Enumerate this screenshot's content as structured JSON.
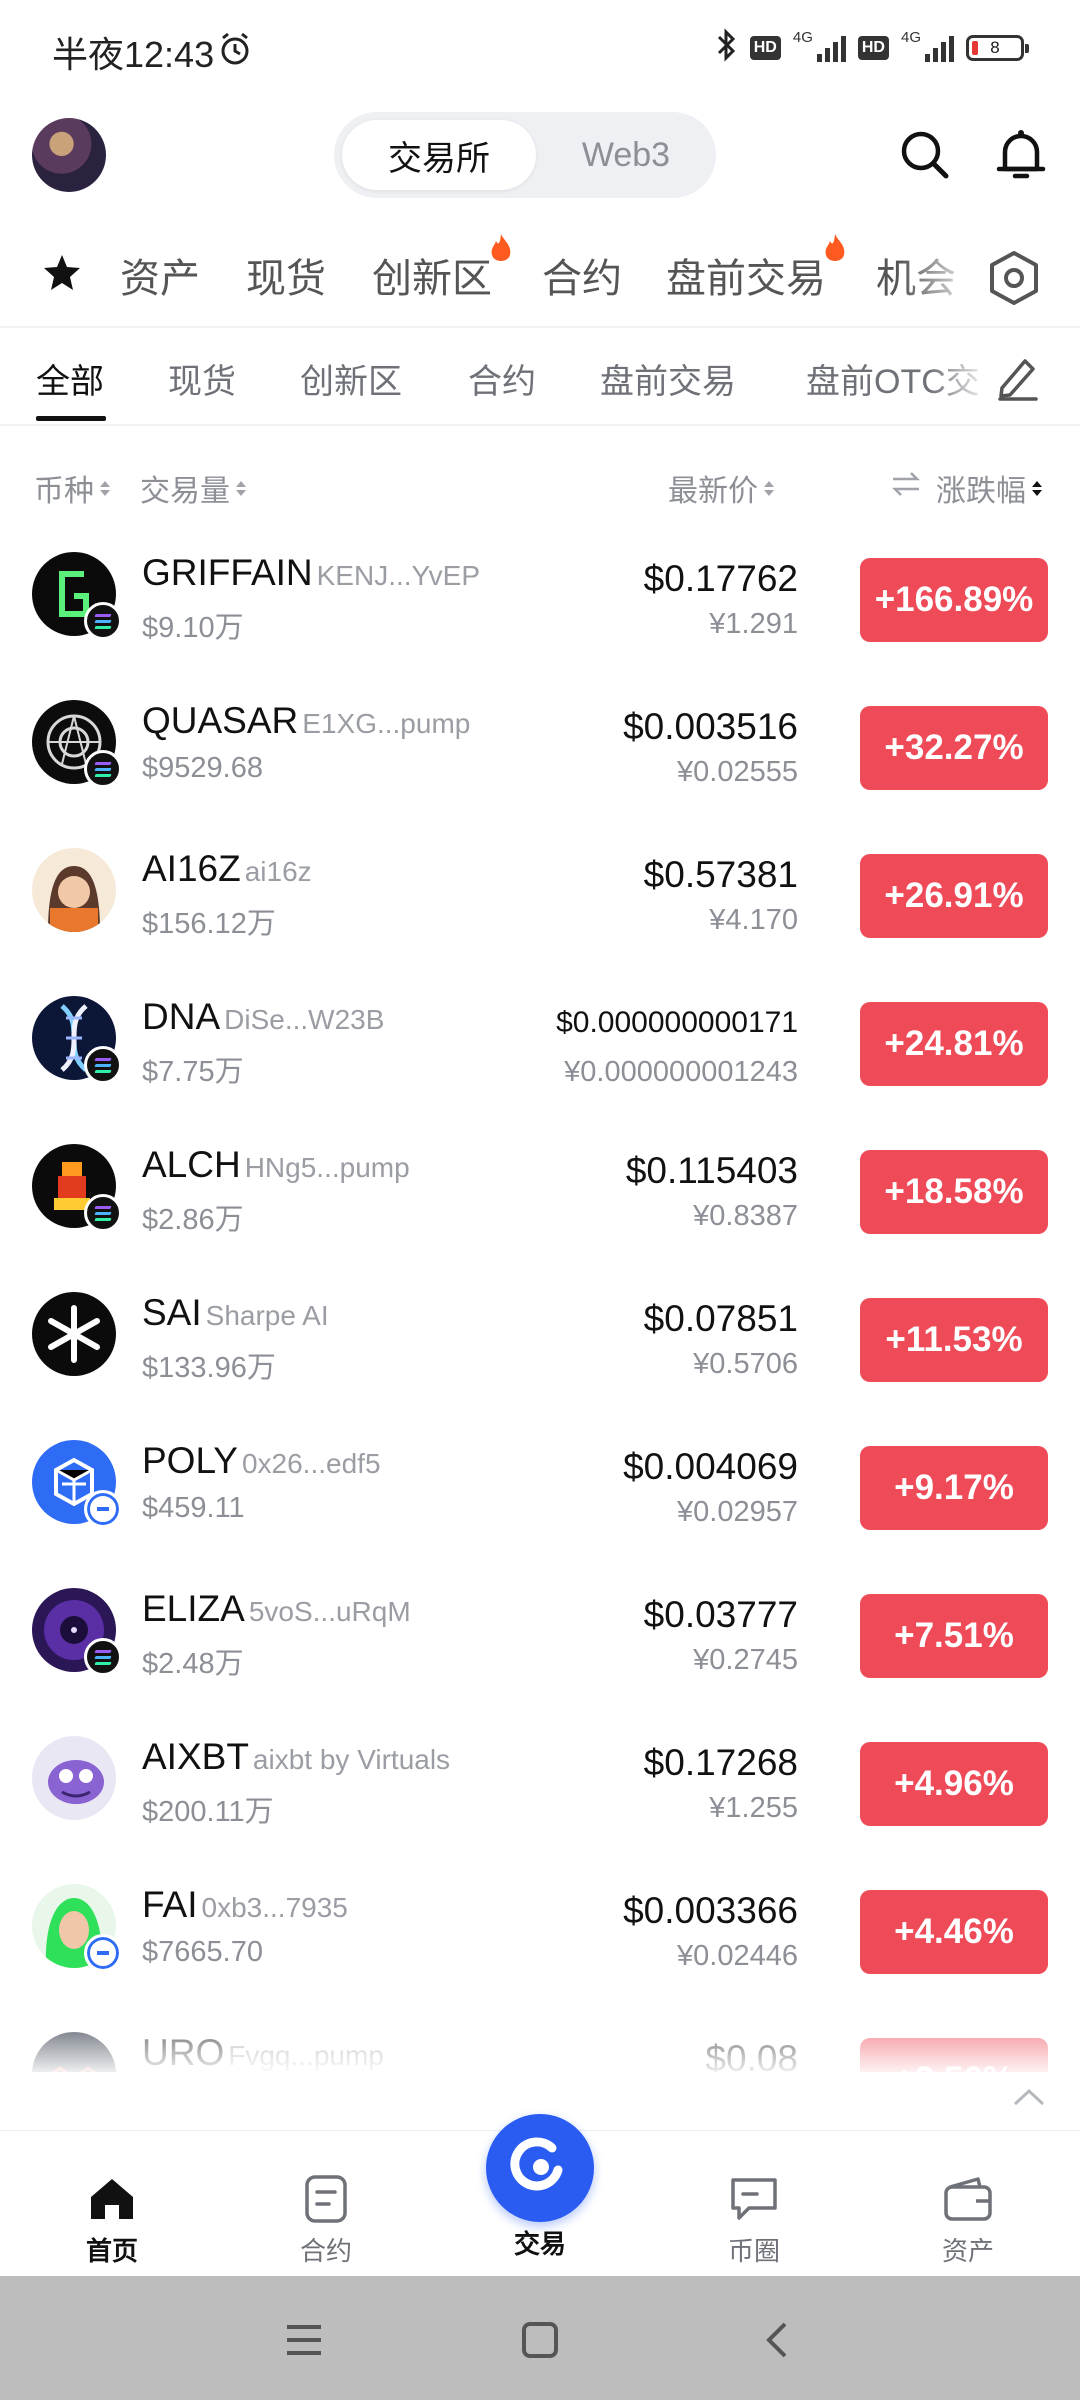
{
  "status_bar": {
    "time": "半夜12:43",
    "hd1": "HD",
    "net1": "4G",
    "hd2": "HD",
    "net2": "4G",
    "battery": "8"
  },
  "header": {
    "tabs": [
      "交易所",
      "Web3"
    ],
    "active_tab": "交易所"
  },
  "category_tabs": [
    {
      "label": "资产",
      "hot": false
    },
    {
      "label": "现货",
      "hot": false
    },
    {
      "label": "创新区",
      "hot": true
    },
    {
      "label": "合约",
      "hot": false
    },
    {
      "label": "盘前交易",
      "hot": true
    },
    {
      "label": "机会",
      "hot": false
    }
  ],
  "sub_tabs": {
    "items": [
      "全部",
      "现货",
      "创新区",
      "合约",
      "盘前交易",
      "盘前OTC交"
    ],
    "active": "全部"
  },
  "columns": {
    "coin": "币种",
    "volume": "交易量",
    "last_price": "最新价",
    "change": "涨跌幅"
  },
  "tokens": [
    {
      "symbol": "GRIFFAIN",
      "sub": "KENJ...YvEP",
      "volume": "$9.10万",
      "price": "$0.17762",
      "cny": "¥1.291",
      "change": "+166.89%",
      "chain": "sol",
      "logo": "griffain"
    },
    {
      "symbol": "QUASAR",
      "sub": "E1XG...pump",
      "volume": "$9529.68",
      "price": "$0.003516",
      "cny": "¥0.02555",
      "change": "+32.27%",
      "chain": "sol",
      "logo": "quasar"
    },
    {
      "symbol": "AI16Z",
      "sub": "ai16z",
      "volume": "$156.12万",
      "price": "$0.57381",
      "cny": "¥4.170",
      "change": "+26.91%",
      "chain": "none",
      "logo": "ai16z"
    },
    {
      "symbol": "DNA",
      "sub": "DiSe...W23B",
      "volume": "$7.75万",
      "price": "$0.000000000171",
      "cny": "¥0.000000001243",
      "change": "+24.81%",
      "chain": "sol",
      "logo": "dna"
    },
    {
      "symbol": "ALCH",
      "sub": "HNg5...pump",
      "volume": "$2.86万",
      "price": "$0.115403",
      "cny": "¥0.8387",
      "change": "+18.58%",
      "chain": "sol",
      "logo": "alch"
    },
    {
      "symbol": "SAI",
      "sub": "Sharpe AI",
      "volume": "$133.96万",
      "price": "$0.07851",
      "cny": "¥0.5706",
      "change": "+11.53%",
      "chain": "none",
      "logo": "sai"
    },
    {
      "symbol": "POLY",
      "sub": "0x26...edf5",
      "volume": "$459.11",
      "price": "$0.004069",
      "cny": "¥0.02957",
      "change": "+9.17%",
      "chain": "eth",
      "logo": "poly"
    },
    {
      "symbol": "ELIZA",
      "sub": "5voS...uRqM",
      "volume": "$2.48万",
      "price": "$0.03777",
      "cny": "¥0.2745",
      "change": "+7.51%",
      "chain": "sol",
      "logo": "eliza"
    },
    {
      "symbol": "AIXBT",
      "sub": "aixbt by Virtuals",
      "volume": "$200.11万",
      "price": "$0.17268",
      "cny": "¥1.255",
      "change": "+4.96%",
      "chain": "none",
      "logo": "aixbt"
    },
    {
      "symbol": "FAI",
      "sub": "0xb3...7935",
      "volume": "$7665.70",
      "price": "$0.003366",
      "cny": "¥0.02446",
      "change": "+4.46%",
      "chain": "eth",
      "logo": "fai"
    },
    {
      "symbol": "URO",
      "sub": "Fvgq...pump",
      "volume": "",
      "price": "$0.08",
      "cny": "",
      "change": "+2.56%",
      "chain": "none",
      "logo": "uro"
    }
  ],
  "bottom_nav": [
    {
      "label": "首页",
      "icon": "home-icon",
      "active": true
    },
    {
      "label": "合约",
      "icon": "contract-icon",
      "active": false
    },
    {
      "label": "交易",
      "icon": "trade-icon",
      "active": false
    },
    {
      "label": "币圈",
      "icon": "chat-icon",
      "active": false
    },
    {
      "label": "资产",
      "icon": "wallet-icon",
      "active": false
    }
  ],
  "colors": {
    "accent_blue": "#2a5cf2",
    "change_red": "#ee4a57",
    "fire_orange": "#ff5a1f"
  }
}
